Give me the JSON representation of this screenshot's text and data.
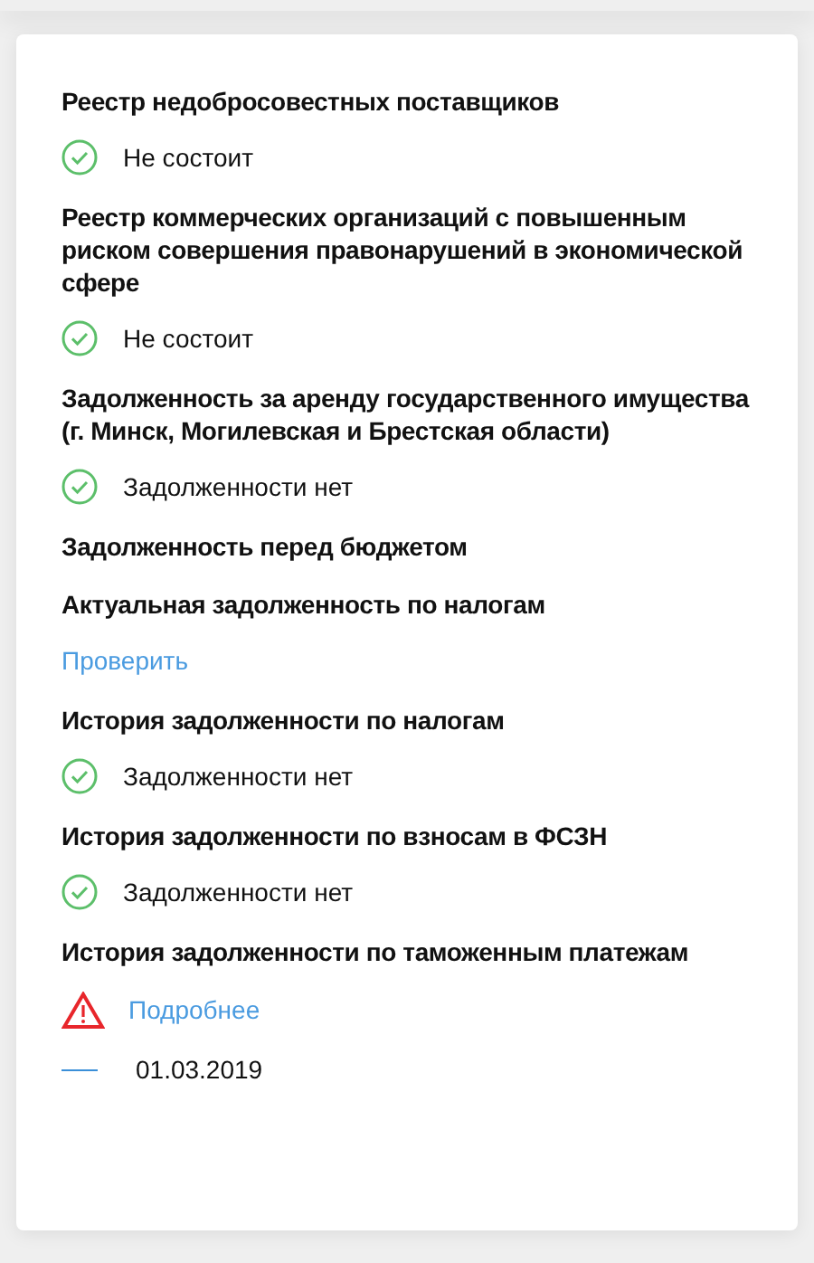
{
  "sections": [
    {
      "title": "Реестр недобросовестных поставщиков",
      "rows": [
        {
          "kind": "ok",
          "text": "Не состоит"
        }
      ]
    },
    {
      "title": "Реестр коммерческих организаций с повышенным риском совершения правонарушений в экономической сфере",
      "rows": [
        {
          "kind": "ok",
          "text": "Не состоит"
        }
      ]
    },
    {
      "title": "Задолженность за аренду государственного имущества (г. Минск, Могилевская и Брестская области)",
      "rows": [
        {
          "kind": "ok",
          "text": "Задолженности нет"
        }
      ]
    },
    {
      "title": "Задолженность перед бюджетом"
    },
    {
      "title": "Актуальная задолженность по налогам",
      "rows": [
        {
          "kind": "link",
          "text": "Проверить"
        }
      ]
    },
    {
      "title": "История задолженности по налогам",
      "rows": [
        {
          "kind": "ok",
          "text": "Задолженности нет"
        }
      ]
    },
    {
      "title": "История задолженности по взносам в ФСЗН",
      "rows": [
        {
          "kind": "ok",
          "text": "Задолженности нет"
        }
      ]
    },
    {
      "title": "История задолженности по таможенным платежам",
      "rows": [
        {
          "kind": "warning",
          "text": "Подробнее"
        },
        {
          "kind": "date",
          "text": "01.03.2019"
        }
      ]
    }
  ]
}
